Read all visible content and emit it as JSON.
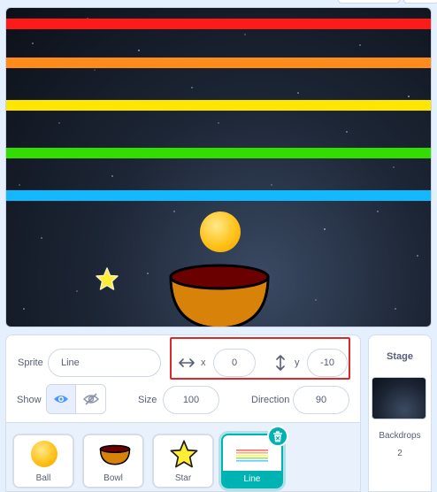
{
  "stage": {
    "stripe_colors": [
      "#ff1a1a",
      "#ff8c1a",
      "#ffe600",
      "#33dd00",
      "#14b8ff"
    ],
    "sprites": [
      "ball-sprite",
      "bowl-sprite",
      "star-sprite"
    ]
  },
  "sprite_info": {
    "sprite_label": "Sprite",
    "sprite_name": "Line",
    "x_label": "x",
    "x_value": "0",
    "y_label": "y",
    "y_value": "-10",
    "show_label": "Show",
    "size_label": "Size",
    "size_value": "100",
    "direction_label": "Direction",
    "direction_value": "90"
  },
  "sprite_list": [
    {
      "name": "Ball"
    },
    {
      "name": "Bowl"
    },
    {
      "name": "Star"
    },
    {
      "name": "Line",
      "selected": true
    }
  ],
  "stage_panel": {
    "title": "Stage",
    "backdrops_label": "Backdrops",
    "backdrops_count": "2"
  },
  "colors": {
    "accent_teal": "#00b3b3",
    "highlight_red": "#e0282b",
    "eye_blue": "#4c97ff"
  }
}
